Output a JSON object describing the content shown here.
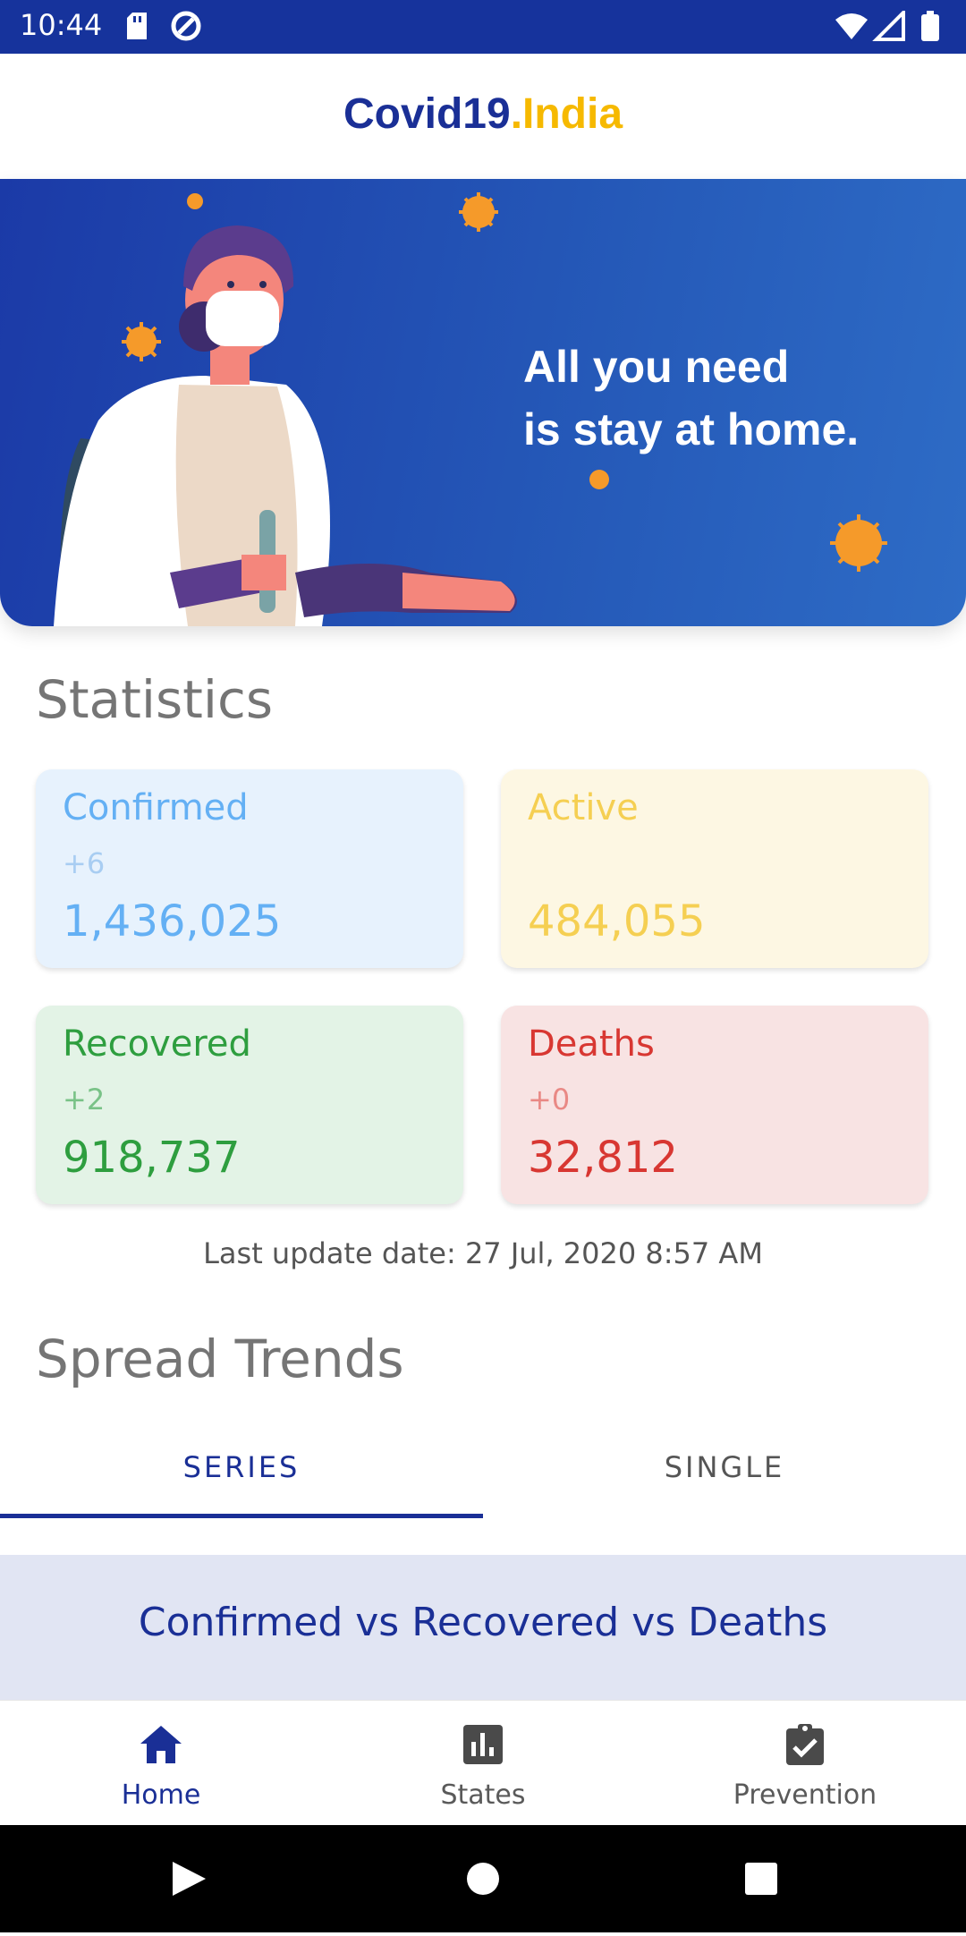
{
  "status_bar": {
    "time": "10:44"
  },
  "app": {
    "brand_main": "Covid19",
    "brand_accent": ".India"
  },
  "hero": {
    "line1": "All you need",
    "line2": "is stay at home."
  },
  "statistics": {
    "title": "Statistics",
    "cards": [
      {
        "label": "Confirmed",
        "delta": "+6",
        "value": "1,436,025"
      },
      {
        "label": "Active",
        "delta": "",
        "value": "484,055"
      },
      {
        "label": "Recovered",
        "delta": "+2",
        "value": "918,737"
      },
      {
        "label": "Deaths",
        "delta": "+0",
        "value": "32,812"
      }
    ],
    "last_update": "Last update date: 27 Jul, 2020 8:57 AM"
  },
  "trends": {
    "title": "Spread Trends",
    "tabs": [
      {
        "label": "SERIES"
      },
      {
        "label": "SINGLE"
      }
    ],
    "chart_title": "Confirmed vs Recovered vs Deaths"
  },
  "bottom_nav": {
    "items": [
      {
        "label": "Home",
        "icon": "home-icon"
      },
      {
        "label": "States",
        "icon": "bar-chart-icon"
      },
      {
        "label": "Prevention",
        "icon": "clipboard-check-icon"
      }
    ]
  },
  "colors": {
    "primary": "#1a2f96",
    "accent": "#f6b900",
    "confirmed": "#64b0f4",
    "confirmed_bg": "#e7f2fd",
    "active": "#f5cf52",
    "active_bg": "#fdf7e3",
    "recovered": "#2e9e3f",
    "recovered_bg": "#e3f3e6",
    "deaths": "#d83732",
    "deaths_bg": "#f8e3e3"
  }
}
